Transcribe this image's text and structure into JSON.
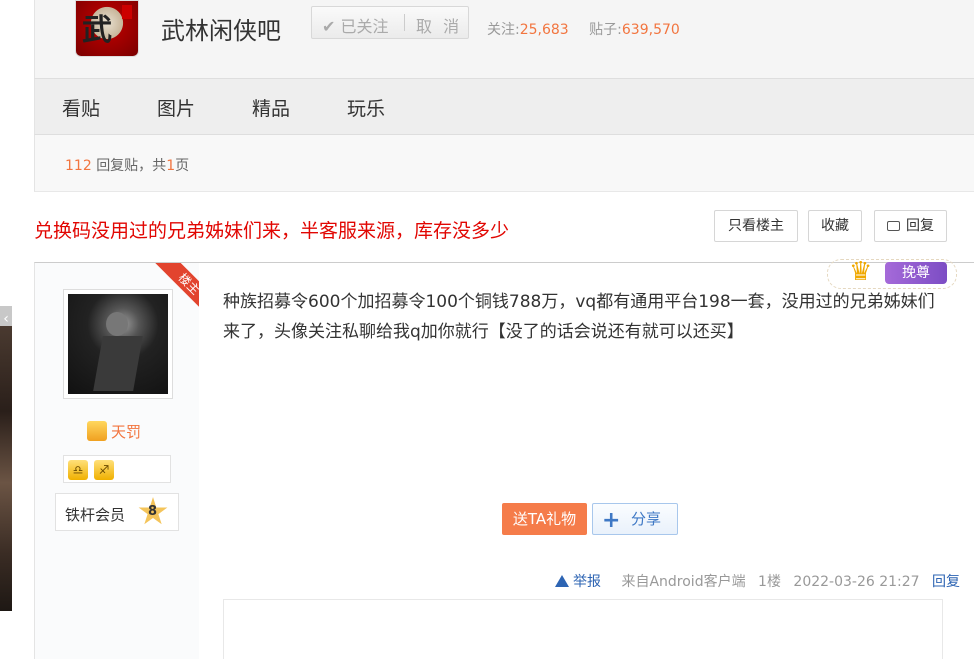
{
  "forum": {
    "name": "武林闲侠吧",
    "logo_icon": "forum-logo",
    "followed_label": "已关注",
    "unfollow_label": "取 消",
    "follow_count_label": "关注:",
    "follow_count": "25,683",
    "post_count_label": "贴子:",
    "post_count": "639,570"
  },
  "nav": {
    "items": [
      "看贴",
      "图片",
      "精品",
      "玩乐"
    ]
  },
  "pager": {
    "reply_count": "112",
    "reply_label": "回复贴，共",
    "page_count": "1",
    "page_label": "页"
  },
  "thread": {
    "title": "兑换码没用过的兄弟姊妹们来，半客服来源，库存没多少",
    "only_op_label": "只看楼主",
    "favorite_label": "收藏",
    "reply_label": "回复"
  },
  "post": {
    "op_ribbon": "楼主",
    "username": "天罚",
    "level_name": "铁杆会员",
    "level_num": "8",
    "badges": [
      "♎",
      "♐"
    ],
    "vip_label": "挽尊",
    "content": "种族招募令600个加招募令100个铜钱788万，vq都有通用平台198一套，没用过的兄弟姊妹们来了，头像关注私聊给我q加你就行【没了的话会说还有就可以还买】",
    "gift_label": "送TA礼物",
    "share_label": "分享",
    "report_label": "举报",
    "source": "来自Android客户端",
    "floor": "1楼",
    "time": "2022-03-26 21:27",
    "reply_label": "回复"
  },
  "colors": {
    "accent": "#f2753f",
    "title_red": "#e10602",
    "link_blue": "#2d64b3"
  }
}
